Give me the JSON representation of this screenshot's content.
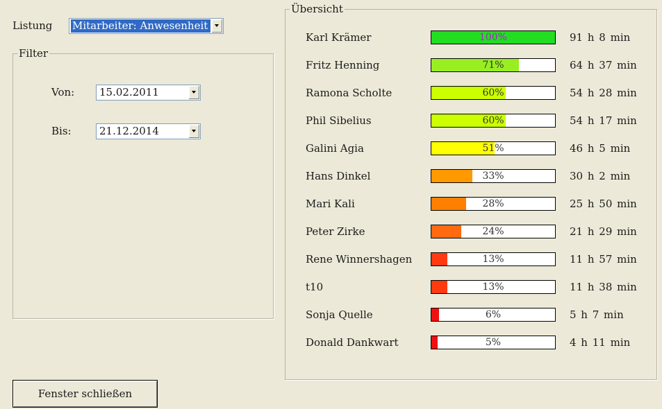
{
  "listung": {
    "label": "Listung",
    "selected": "Mitarbeiter: Anwesenheit"
  },
  "filter": {
    "legend": "Filter",
    "von_label": "Von:",
    "von_value": "15.02.2011",
    "bis_label": "Bis:",
    "bis_value": "21.12.2014"
  },
  "overview": {
    "legend": "Übersicht",
    "rows": [
      {
        "name": "Karl Krämer",
        "percent": 100,
        "pct_label": "100%",
        "color": "#22DD22",
        "pct_color": "#AA22CC",
        "time": "91 h  8 min"
      },
      {
        "name": "Fritz Henning",
        "percent": 71,
        "pct_label": "71%",
        "color": "#99EE22",
        "pct_color": "#333333",
        "time": "64 h  37 min"
      },
      {
        "name": "Ramona Scholte",
        "percent": 60,
        "pct_label": "60%",
        "color": "#CCFF00",
        "pct_color": "#333333",
        "time": "54 h  28 min"
      },
      {
        "name": "Phil Sibelius",
        "percent": 60,
        "pct_label": "60%",
        "color": "#CCFF00",
        "pct_color": "#333333",
        "time": "54 h  17 min"
      },
      {
        "name": "Galini Agia",
        "percent": 51,
        "pct_label": "51%",
        "color": "#FFFF00",
        "pct_color": "#333333",
        "time": "46 h  5 min"
      },
      {
        "name": "Hans Dinkel",
        "percent": 33,
        "pct_label": "33%",
        "color": "#FF9900",
        "pct_color": "#333333",
        "time": "30 h  2 min"
      },
      {
        "name": "Mari Kali",
        "percent": 28,
        "pct_label": "28%",
        "color": "#FF7F00",
        "pct_color": "#333333",
        "time": "25 h  50 min"
      },
      {
        "name": "Peter Zirke",
        "percent": 24,
        "pct_label": "24%",
        "color": "#FF6A10",
        "pct_color": "#333333",
        "time": "21 h  29 min"
      },
      {
        "name": "Rene Winnershagen",
        "percent": 13,
        "pct_label": "13%",
        "color": "#FF3A10",
        "pct_color": "#333333",
        "time": "11 h  57 min"
      },
      {
        "name": "t10",
        "percent": 13,
        "pct_label": "13%",
        "color": "#FF3A10",
        "pct_color": "#333333",
        "time": "11 h  38 min"
      },
      {
        "name": "Sonja Quelle",
        "percent": 6,
        "pct_label": "6%",
        "color": "#EE1111",
        "pct_color": "#333333",
        "time": "5 h  7 min"
      },
      {
        "name": "Donald Dankwart",
        "percent": 5,
        "pct_label": "5%",
        "color": "#EE1111",
        "pct_color": "#333333",
        "time": "4 h  11 min"
      }
    ]
  },
  "close_button": {
    "label": "Fenster schließen"
  }
}
